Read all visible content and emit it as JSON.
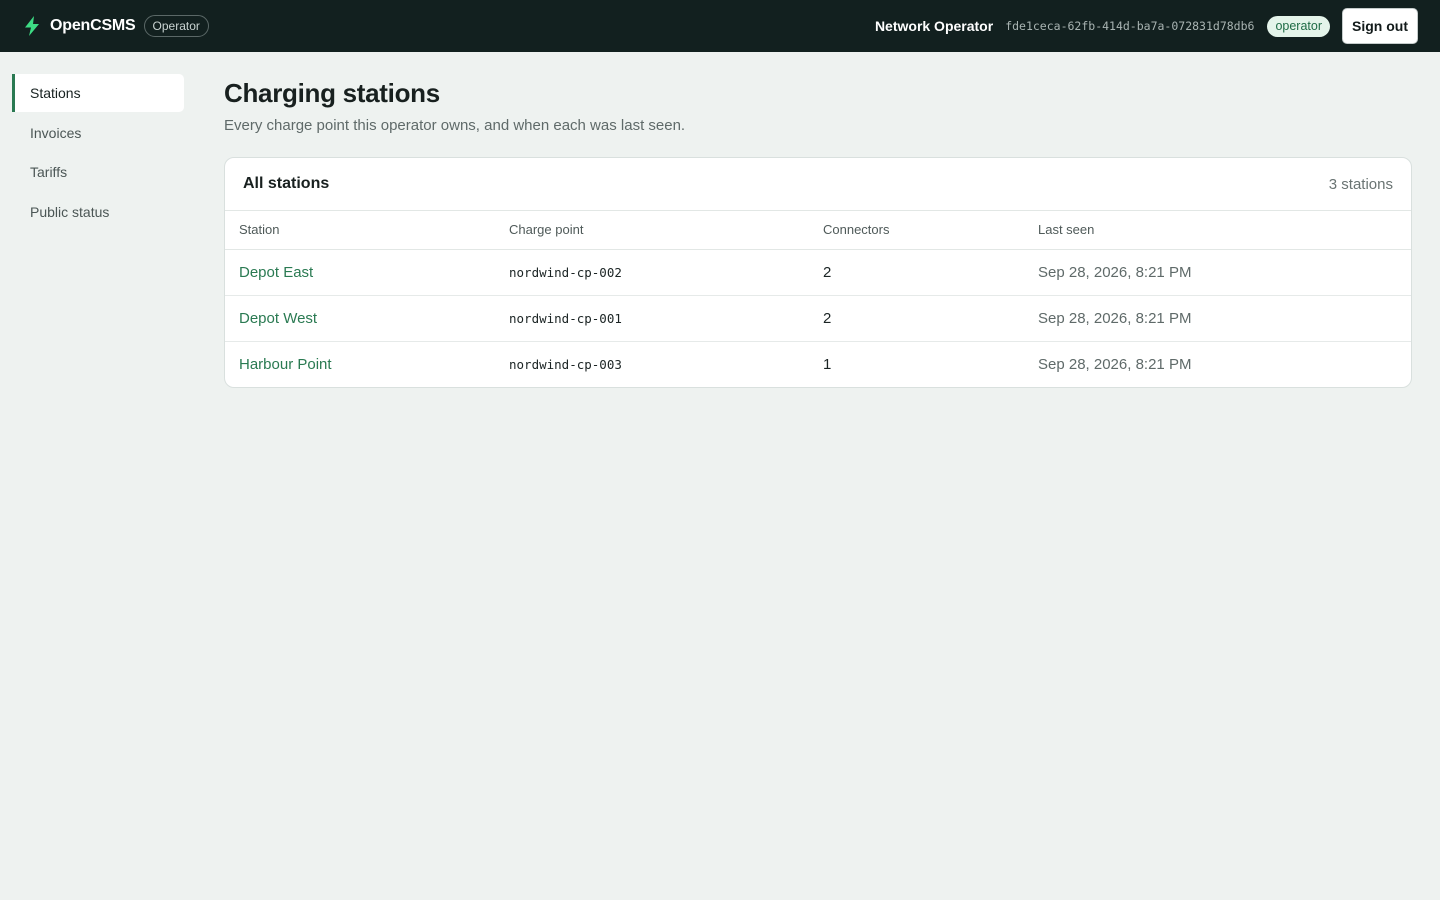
{
  "header": {
    "brand_name": "OpenCSMS",
    "brand_role": "Operator",
    "brand_icon": "lightning-bolt-icon",
    "user_name": "Network Operator",
    "user_id": "fde1ceca-62fb-414d-ba7a-072831d78db6",
    "role_badge": "operator",
    "signout_label": "Sign out"
  },
  "sidebar": {
    "items": [
      {
        "label": "Stations",
        "active": true
      },
      {
        "label": "Invoices",
        "active": false
      },
      {
        "label": "Tariffs",
        "active": false
      },
      {
        "label": "Public status",
        "active": false
      }
    ]
  },
  "main": {
    "title": "Charging stations",
    "subtitle": "Every charge point this operator owns, and when each was last seen.",
    "card": {
      "title": "All stations",
      "count": "3 stations",
      "columns": [
        "Station",
        "Charge point",
        "Connectors",
        "Last seen"
      ],
      "rows": [
        {
          "station": "Depot East",
          "charge_point": "nordwind-cp-002",
          "connectors": "2",
          "last_seen": "Sep 28, 2026, 8:21 PM"
        },
        {
          "station": "Depot West",
          "charge_point": "nordwind-cp-001",
          "connectors": "2",
          "last_seen": "Sep 28, 2026, 8:21 PM"
        },
        {
          "station": "Harbour Point",
          "charge_point": "nordwind-cp-003",
          "connectors": "1",
          "last_seen": "Sep 28, 2026, 8:21 PM"
        }
      ]
    }
  },
  "colors": {
    "topbar": "#12201f",
    "accent": "#2a7a52",
    "brand_icon": "#3ddc84",
    "background": "#eef2f0"
  }
}
